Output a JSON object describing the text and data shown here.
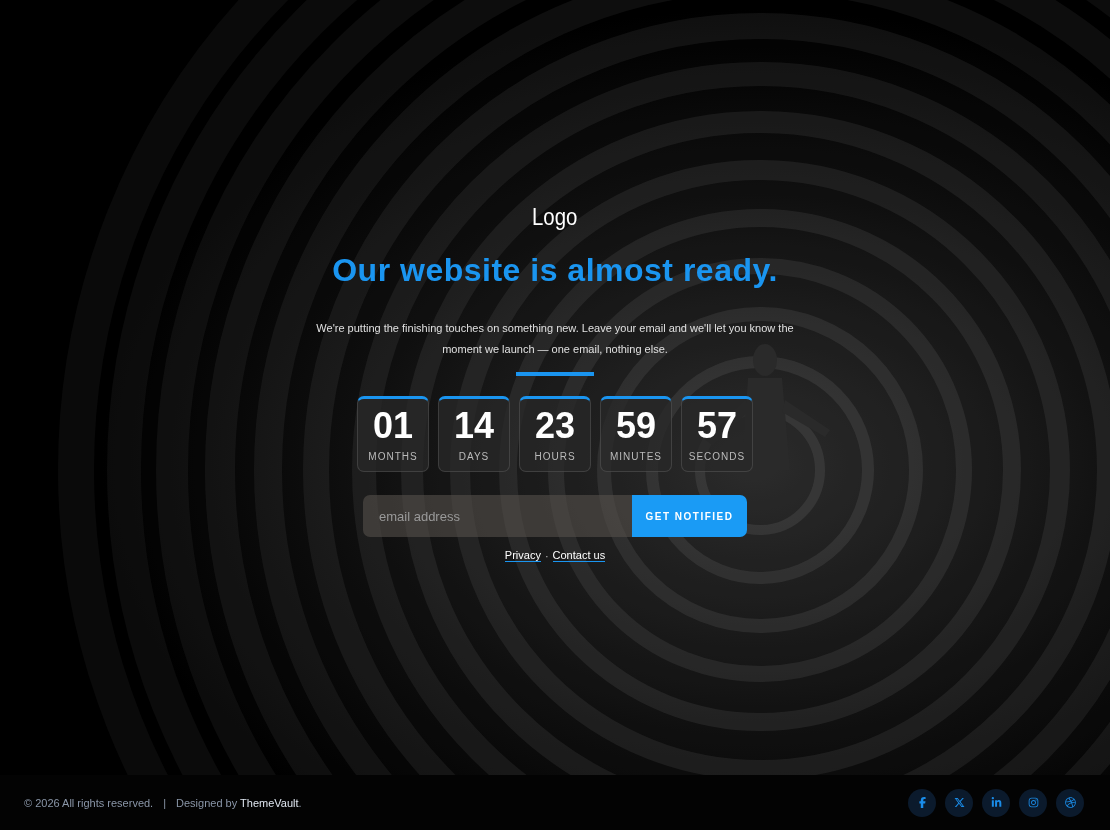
{
  "logo": "Logo",
  "headline": "Our website is almost ready.",
  "intro": "We're putting the finishing touches on something new. Leave your email and we'll let you know the moment we launch — one email, nothing else.",
  "countdown": [
    {
      "value": "01",
      "unit": "MONTHS"
    },
    {
      "value": "14",
      "unit": "DAYS"
    },
    {
      "value": "23",
      "unit": "HOURS"
    },
    {
      "value": "59",
      "unit": "MINUTES"
    },
    {
      "value": "57",
      "unit": "SECONDS"
    }
  ],
  "signup": {
    "placeholder": "email address",
    "button": "GET NOTIFIED"
  },
  "links": [
    "Privacy",
    "Contact us"
  ],
  "link_separator": "·",
  "footer": {
    "copyright": "© 2026 All rights reserved.",
    "separator": "|",
    "credit": "Designed by **ThemeVault**.",
    "social": [
      {
        "kind": "facebook"
      },
      {
        "kind": "x"
      },
      {
        "kind": "linkedin"
      },
      {
        "kind": "instagram"
      },
      {
        "kind": "dribbble"
      }
    ]
  }
}
